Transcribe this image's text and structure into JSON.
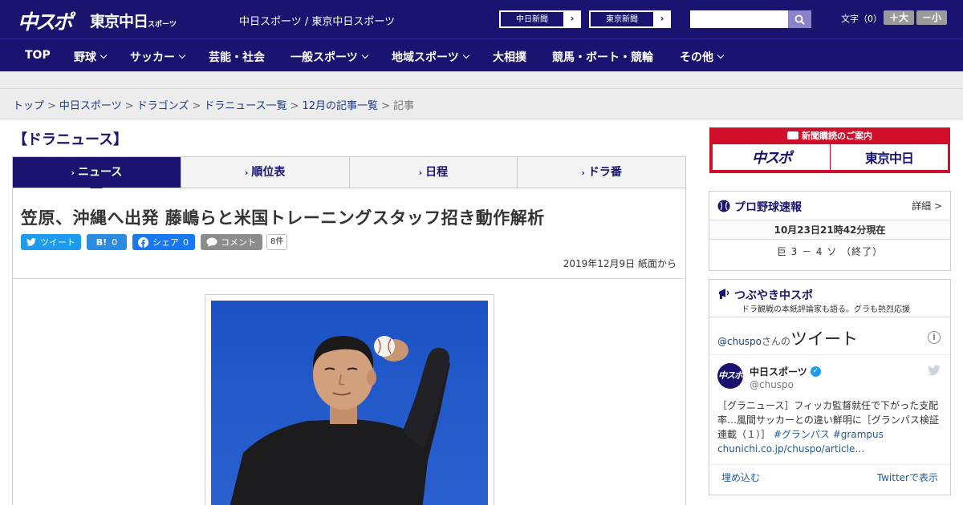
{
  "header": {
    "logo_chuspo": "中スポ",
    "logo_tokyo": "東京中日",
    "logo_tokyo_small": "スポーツ",
    "site_title": "中日スポーツ / 東京中日スポーツ",
    "btn_chunichi": "中日新聞",
    "btn_tokyo": "東京新聞",
    "font_label": "文字（0）",
    "font_bigger": "＋大",
    "font_smaller": "－小"
  },
  "nav": {
    "items": [
      {
        "label": "TOP",
        "has_menu": false
      },
      {
        "label": "野球",
        "has_menu": true
      },
      {
        "label": "サッカー",
        "has_menu": true
      },
      {
        "label": "芸能・社会",
        "has_menu": false
      },
      {
        "label": "一般スポーツ",
        "has_menu": true
      },
      {
        "label": "地域スポーツ",
        "has_menu": true
      },
      {
        "label": "大相撲",
        "has_menu": false
      },
      {
        "label": "競馬・ボート・競輪",
        "has_menu": false
      },
      {
        "label": "その他",
        "has_menu": true
      }
    ]
  },
  "breadcrumb": {
    "items": [
      "トップ",
      "中日スポーツ",
      "ドラゴンズ",
      "ドラニュース一覧",
      "12月の記事一覧"
    ],
    "current": "記事",
    "separator": ">"
  },
  "section": {
    "title": "【ドラニュース】"
  },
  "tabs": [
    {
      "label": "ニュース",
      "active": true
    },
    {
      "label": "順位表",
      "active": false
    },
    {
      "label": "日程",
      "active": false
    },
    {
      "label": "ドラ番",
      "active": false
    }
  ],
  "article": {
    "headline": "笠原、沖縄へ出発 藤嶋らと米国トレーニングスタッフ招き動作解析",
    "share": {
      "tweet": "ツイート",
      "hatena": "B!",
      "hatena_count": "0",
      "facebook": "シェア",
      "facebook_count": "0",
      "comment": "コメント",
      "comment_count": "8件"
    },
    "date": "2019年12月9日 紙面から"
  },
  "sidebar": {
    "promo_title": "新聞購読のご案内",
    "promo_logo_a": "中スポ",
    "promo_logo_b": "東京中日",
    "baseball": {
      "title": "プロ野球速報",
      "detail": "詳細 >",
      "time": "10月23日21時42分現在",
      "score": "巨 3 － 4 ソ （終了）"
    },
    "tweet": {
      "title": "つぶやき中スポ",
      "subtitle": "ドラ観戦の本紙評論家も語る。グラも熱烈応援",
      "handle": "@chuspo",
      "handle_suffix": "さんの",
      "tweet_word": "ツイート",
      "name": "中日スポーツ",
      "screen_name": "@chuspo",
      "avatar": "中スポ",
      "text_main": "［グラニュース］フィッカ監督就任で下がった支配率…風間サッカーとの違い鮮明に［グランパス検証連載（１）］",
      "tag1": "#グランパス",
      "tag2": "#grampus",
      "link": "chunichi.co.jp/chuspo/article…",
      "embed": "埋め込む",
      "view": "Twitterで表示"
    }
  },
  "colors": {
    "navy": "#1a1470",
    "promo_red": "#d10f2a",
    "twitter_blue": "#1d9bf0",
    "facebook_blue": "#1877f2"
  }
}
